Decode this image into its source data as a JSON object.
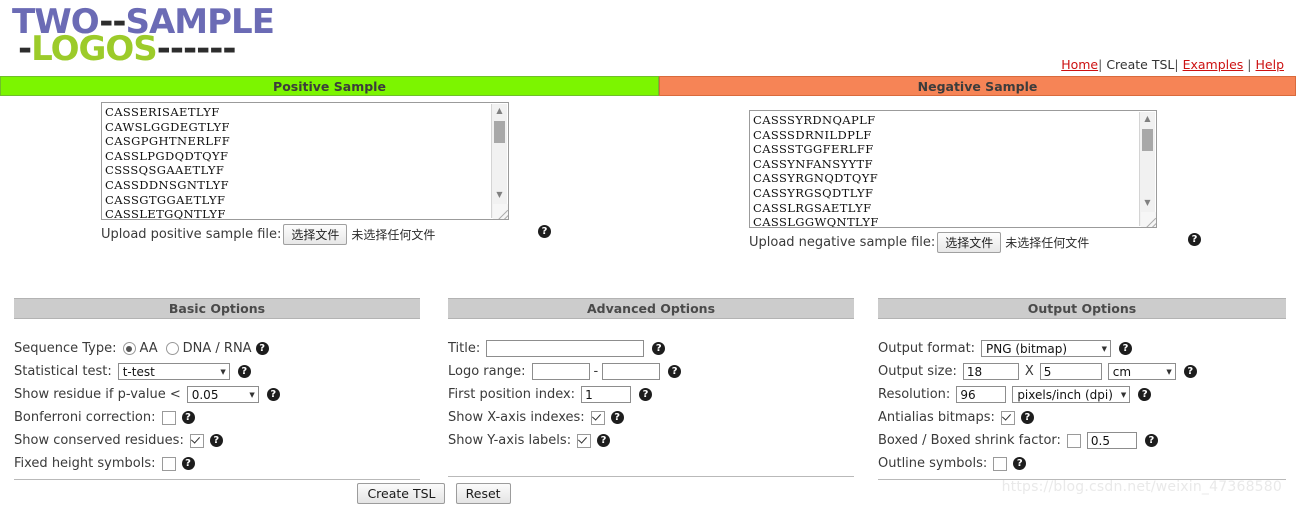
{
  "brand": {
    "line1_a": "TWO",
    "line1_dash": "--",
    "line1_b": "SAMPLE",
    "line2_dash_left": "-",
    "line2_text": "LOGOS",
    "line2_dash_right": "------",
    "color_purple": "#6b6bb5",
    "color_green": "#9ccb2a"
  },
  "nav": {
    "home": "Home",
    "sep1": "|",
    "create_tsl": "Create TSL",
    "sep2": "|",
    "examples": "Examples",
    "sep3": "|",
    "help": "Help"
  },
  "banners": {
    "positive": "Positive Sample",
    "negative": "Negative Sample",
    "positive_color": "#7cf500",
    "negative_color": "#f68456"
  },
  "positive_sample": {
    "sequences": [
      "CASSERISAETLYF",
      "CAWSLGGDEGTLYF",
      "CASGPGHTNERLFF",
      "CASSLPGDQDTQYF",
      "CSSSQSGAAETLYF",
      "CASSDDNSGNTLYF",
      "CASSGTGGAETLYF",
      "CASSLETGQNTLYF"
    ],
    "upload_label": "Upload positive sample file:",
    "file_button": "选择文件",
    "file_status": "未选择任何文件",
    "help_icon": "question-mark-icon"
  },
  "negative_sample": {
    "sequences": [
      "CASSSYRDNQAPLF",
      "CASSSDRNILDPLF",
      "CASSSTGGFERLFF",
      "CASSYNFANSYYTF",
      "CASSYRGNQDTQYF",
      "CASSYRGSQDTLYF",
      "CASSLRGSAETLYF",
      "CASSLGGWQNTLYF"
    ],
    "upload_label": "Upload negative sample file:",
    "file_button": "选择文件",
    "file_status": "未选择任何文件",
    "help_icon": "question-mark-icon"
  },
  "basic_options": {
    "title": "Basic Options",
    "sequence_type_label": "Sequence Type:",
    "sequence_type_aa": "AA",
    "sequence_type_dna": "DNA / RNA",
    "sequence_type_selected": "AA",
    "statistical_test_label": "Statistical test:",
    "statistical_test_value": "t-test",
    "p_value_label": "Show residue if p-value <",
    "p_value_value": "0.05",
    "bonferroni_label": "Bonferroni correction:",
    "bonferroni_checked": false,
    "conserved_label": "Show conserved residues:",
    "conserved_checked": true,
    "fixed_height_label": "Fixed height symbols:",
    "fixed_height_checked": false
  },
  "advanced_options": {
    "title": "Advanced Options",
    "title_label": "Title:",
    "title_value": "",
    "logo_range_label": "Logo range:",
    "logo_range_from": "",
    "logo_range_sep": "-",
    "logo_range_to": "",
    "first_position_label": "First position index:",
    "first_position_value": "1",
    "show_x_label": "Show X-axis indexes:",
    "show_x_checked": true,
    "show_y_label": "Show Y-axis labels:",
    "show_y_checked": true
  },
  "output_options": {
    "title": "Output Options",
    "format_label": "Output format:",
    "format_value": "PNG (bitmap)",
    "size_label": "Output size:",
    "size_width": "18",
    "size_x": "X",
    "size_height": "5",
    "size_unit": "cm",
    "resolution_label": "Resolution:",
    "resolution_value": "96",
    "resolution_unit": "pixels/inch (dpi)",
    "antialias_label": "Antialias bitmaps:",
    "antialias_checked": true,
    "boxed_label": "Boxed / Boxed shrink factor:",
    "boxed_checked": false,
    "boxed_value": "0.5",
    "outline_label": "Outline symbols:",
    "outline_checked": false
  },
  "actions": {
    "create": "Create TSL",
    "reset": "Reset"
  },
  "watermark": "https://blog.csdn.net/weixin_47368580"
}
